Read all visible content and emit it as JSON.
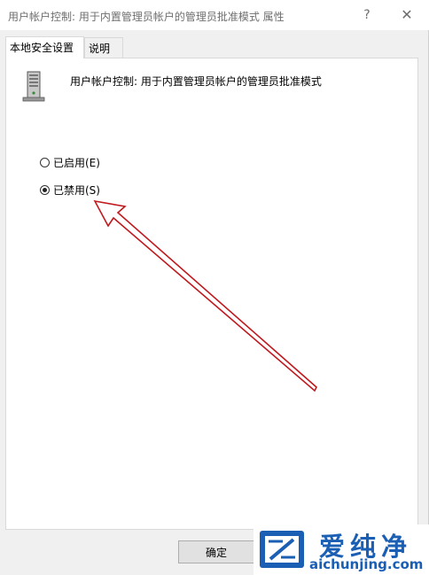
{
  "window": {
    "title": "用户帐户控制: 用于内置管理员帐户的管理员批准模式 属性",
    "help_glyph": "?",
    "close_glyph": "✕"
  },
  "tabs": [
    {
      "label": "本地安全设置",
      "active": true
    },
    {
      "label": "说明",
      "active": false
    }
  ],
  "policy": {
    "icon": "server-icon",
    "name": "用户帐户控制: 用于内置管理员帐户的管理员批准模式"
  },
  "options": [
    {
      "label": "已启用(E)",
      "selected": false
    },
    {
      "label": "已禁用(S)",
      "selected": true
    }
  ],
  "buttons": {
    "ok": "确定"
  },
  "annotation": {
    "color": "#c0191e"
  },
  "watermark": {
    "brand": "爱纯净",
    "url": "aichunjing.com",
    "color": "#1a5fb4"
  }
}
